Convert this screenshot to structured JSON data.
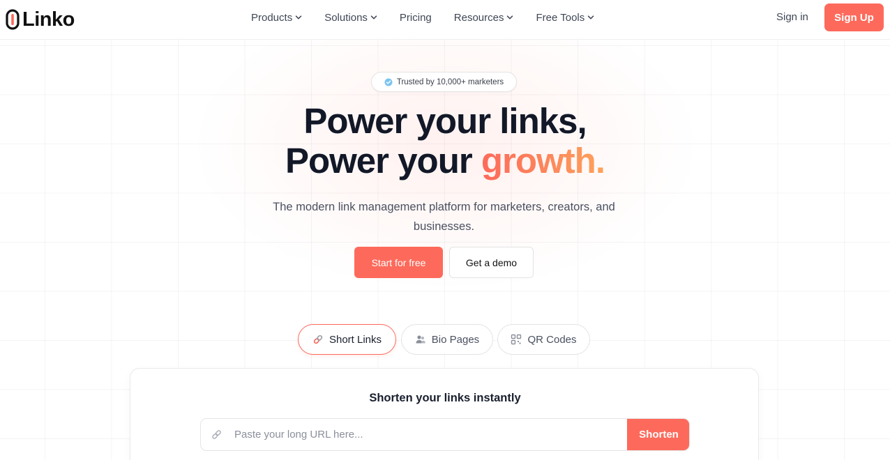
{
  "brand": {
    "name": "Linko",
    "accent": "#fd6a5b"
  },
  "nav": {
    "items": [
      {
        "label": "Products",
        "dropdown": true
      },
      {
        "label": "Solutions",
        "dropdown": true
      },
      {
        "label": "Pricing",
        "dropdown": false
      },
      {
        "label": "Resources",
        "dropdown": true
      },
      {
        "label": "Free Tools",
        "dropdown": true
      }
    ],
    "sign_in": "Sign in",
    "sign_up": "Sign Up"
  },
  "hero": {
    "badge": "Trusted by 10,000+ marketers",
    "title_line1": "Power your links,",
    "title_line2_prefix": "Power your ",
    "title_line2_highlight": "growth.",
    "subtitle": "The modern link management platform for marketers, creators, and businesses.",
    "primary_cta": "Start for free",
    "secondary_cta": "Get a demo"
  },
  "tabs": [
    {
      "label": "Short Links",
      "icon": "link-icon",
      "active": true
    },
    {
      "label": "Bio Pages",
      "icon": "users-icon",
      "active": false
    },
    {
      "label": "QR Codes",
      "icon": "qr-code-icon",
      "active": false
    }
  ],
  "shortener": {
    "title": "Shorten your links instantly",
    "placeholder": "Paste your long URL here...",
    "value": "",
    "button": "Shorten"
  }
}
